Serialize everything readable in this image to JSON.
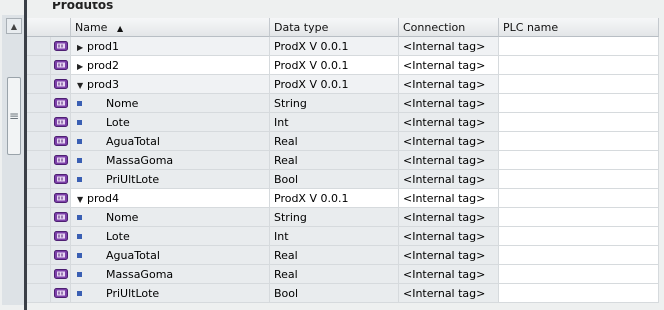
{
  "title": "Produtos",
  "headers": {
    "name": "Name",
    "datatype": "Data type",
    "connection": "Connection",
    "plc": "PLC name"
  },
  "rows": [
    {
      "name": "prod1",
      "type": "ProdX V 0.0.1",
      "conn": "<Internal tag>",
      "kind": "collapsed"
    },
    {
      "name": "prod2",
      "type": "ProdX V 0.0.1",
      "conn": "<Internal tag>",
      "kind": "collapsed"
    },
    {
      "name": "prod3",
      "type": "ProdX V 0.0.1",
      "conn": "<Internal tag>",
      "kind": "expanded"
    },
    {
      "name": "Nome",
      "type": "String",
      "conn": "<Internal tag>",
      "kind": "child"
    },
    {
      "name": "Lote",
      "type": "Int",
      "conn": "<Internal tag>",
      "kind": "child"
    },
    {
      "name": "AguaTotal",
      "type": "Real",
      "conn": "<Internal tag>",
      "kind": "child"
    },
    {
      "name": "MassaGoma",
      "type": "Real",
      "conn": "<Internal tag>",
      "kind": "child"
    },
    {
      "name": "PriUltLote",
      "type": "Bool",
      "conn": "<Internal tag>",
      "kind": "child"
    },
    {
      "name": "prod4",
      "type": "ProdX V 0.0.1",
      "conn": "<Internal tag>",
      "kind": "expanded"
    },
    {
      "name": "Nome",
      "type": "String",
      "conn": "<Internal tag>",
      "kind": "child"
    },
    {
      "name": "Lote",
      "type": "Int",
      "conn": "<Internal tag>",
      "kind": "child"
    },
    {
      "name": "AguaTotal",
      "type": "Real",
      "conn": "<Internal tag>",
      "kind": "child"
    },
    {
      "name": "MassaGoma",
      "type": "Real",
      "conn": "<Internal tag>",
      "kind": "child"
    },
    {
      "name": "PriUltLote",
      "type": "Bool",
      "conn": "<Internal tag>",
      "kind": "child"
    }
  ],
  "icons": {
    "sort": "sort-ascending-icon",
    "tag": "hmi-tag-icon",
    "scroll_up": "scroll-up-icon",
    "grip": "scroll-grip-icon"
  },
  "colors": {
    "tag_icon": "#7b3fa8",
    "bullet": "#3a5fb3"
  }
}
